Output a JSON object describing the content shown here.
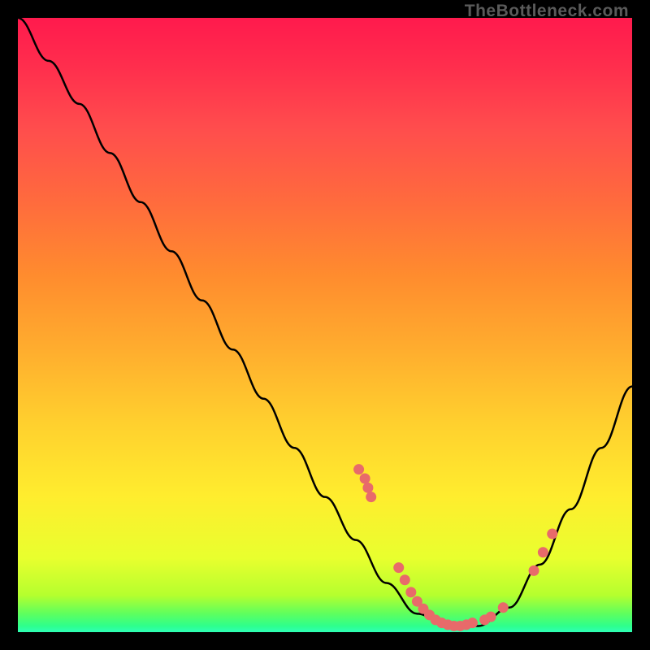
{
  "watermark": "TheBottleneck.com",
  "chart_data": {
    "type": "line",
    "title": "",
    "xlabel": "",
    "ylabel": "",
    "xlim": [
      0,
      100
    ],
    "ylim": [
      0,
      100
    ],
    "curve_points": [
      {
        "x": 0,
        "y": 100
      },
      {
        "x": 5,
        "y": 93
      },
      {
        "x": 10,
        "y": 86
      },
      {
        "x": 15,
        "y": 78
      },
      {
        "x": 20,
        "y": 70
      },
      {
        "x": 25,
        "y": 62
      },
      {
        "x": 30,
        "y": 54
      },
      {
        "x": 35,
        "y": 46
      },
      {
        "x": 40,
        "y": 38
      },
      {
        "x": 45,
        "y": 30
      },
      {
        "x": 50,
        "y": 22
      },
      {
        "x": 55,
        "y": 15
      },
      {
        "x": 60,
        "y": 8
      },
      {
        "x": 65,
        "y": 3
      },
      {
        "x": 70,
        "y": 1
      },
      {
        "x": 75,
        "y": 1
      },
      {
        "x": 80,
        "y": 4
      },
      {
        "x": 85,
        "y": 11
      },
      {
        "x": 90,
        "y": 20
      },
      {
        "x": 95,
        "y": 30
      },
      {
        "x": 100,
        "y": 40
      }
    ],
    "data_points": [
      {
        "x": 55.5,
        "y": 26.5
      },
      {
        "x": 56.5,
        "y": 25
      },
      {
        "x": 57,
        "y": 23.5
      },
      {
        "x": 57.5,
        "y": 22
      },
      {
        "x": 62,
        "y": 10.5
      },
      {
        "x": 63,
        "y": 8.5
      },
      {
        "x": 64,
        "y": 6.5
      },
      {
        "x": 65,
        "y": 5
      },
      {
        "x": 66,
        "y": 3.8
      },
      {
        "x": 67,
        "y": 2.8
      },
      {
        "x": 68,
        "y": 2
      },
      {
        "x": 69,
        "y": 1.5
      },
      {
        "x": 70,
        "y": 1.2
      },
      {
        "x": 71,
        "y": 1
      },
      {
        "x": 72,
        "y": 1
      },
      {
        "x": 73,
        "y": 1.2
      },
      {
        "x": 74,
        "y": 1.5
      },
      {
        "x": 76,
        "y": 2
      },
      {
        "x": 77,
        "y": 2.5
      },
      {
        "x": 79,
        "y": 4
      },
      {
        "x": 84,
        "y": 10
      },
      {
        "x": 85.5,
        "y": 13
      },
      {
        "x": 87,
        "y": 16
      }
    ],
    "gradient_colors": {
      "top": "#ff1a4d",
      "middle": "#ffed2e",
      "bottom": "#2effb5"
    }
  }
}
